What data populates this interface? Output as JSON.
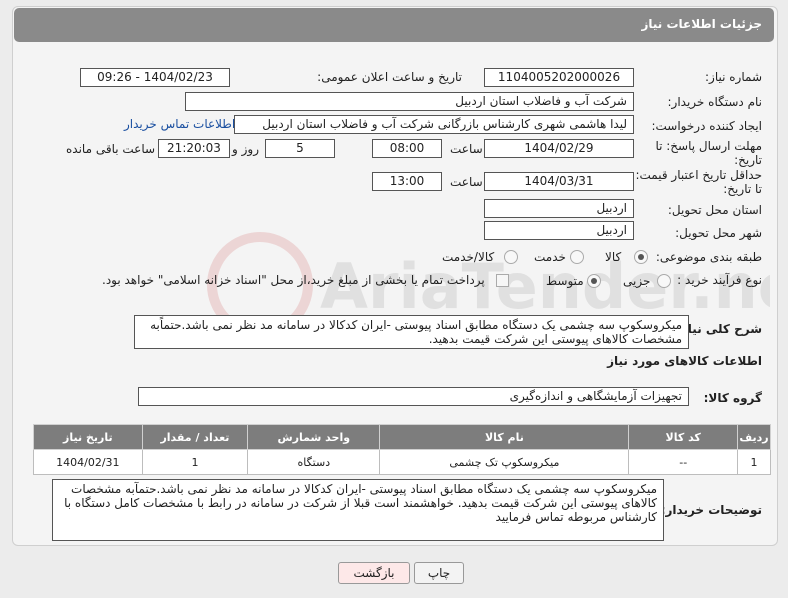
{
  "header": {
    "title": "جزئیات اطلاعات نیاز"
  },
  "form": {
    "need_number_label": "شماره نیاز:",
    "need_number": "1104005202000026",
    "announce_label": "تاریخ و ساعت اعلان عمومی:",
    "announce_value": "1404/02/23 - 09:26",
    "buyer_org_label": "نام دستگاه خریدار:",
    "buyer_org": "شرکت آب و فاضلاب استان اردبیل",
    "creator_label": "ایجاد کننده درخواست:",
    "creator": "لیدا  هاشمی شهری کارشناس بازرگانی شرکت آب و فاضلاب استان اردبیل",
    "contact_link": "اطلاعات تماس خریدار",
    "deadline_label_1": "مهلت ارسال پاسخ: تا",
    "deadline_label_2": "تاریخ:",
    "deadline_date": "1404/02/29",
    "time_label": "ساعت",
    "deadline_time": "08:00",
    "days_value": "5",
    "days_label": "روز و",
    "remaining_time": "21:20:03",
    "remaining_label": "ساعت باقی مانده",
    "price_valid_label_1": "حداقل تاریخ اعتبار قیمت:",
    "price_valid_label_2": "تا تاریخ:",
    "price_valid_date": "1404/03/31",
    "price_valid_time": "13:00",
    "province_label": "استان محل تحویل:",
    "province": "اردبیل",
    "city_label": "شهر محل تحویل:",
    "city": "اردبیل",
    "category_label": "طبقه بندی موضوعی:",
    "category_options": [
      "کالا",
      "خدمت",
      "کالا/خدمت"
    ],
    "process_label": "نوع فرآیند خرید :",
    "process_options": [
      "جزیی",
      "متوسط"
    ],
    "payment_note": "پرداخت تمام یا بخشی از مبلغ خرید،از محل \"اسناد خزانه اسلامی\" خواهد بود.",
    "description_label": "شرح کلی نیاز:",
    "description": "میکروسکوپ سه چشمی  یک دستگاه مطابق اسناد پیوستی -ایران کدکالا در سامانه مد نظر نمی باشد.حتماًبه مشخصات کالاهای پیوستی این شرکت قیمت بدهید."
  },
  "goods": {
    "section_title": "اطلاعات کالاهای مورد نیاز",
    "group_label": "گروه کالا:",
    "group_value": "تجهیزات آزمایشگاهی و اندازه‌گیری",
    "columns": [
      "ردیف",
      "کد کالا",
      "نام کالا",
      "واحد شمارش",
      "تعداد / مقدار",
      "تاریخ نیاز"
    ],
    "rows": [
      [
        "1",
        "--",
        "میکروسکوپ تک چشمی",
        "دستگاه",
        "1",
        "1404/02/31"
      ]
    ]
  },
  "buyer_notes": {
    "label": "توضیحات خریدار:",
    "text": "میکروسکوپ سه چشمی  یک دستگاه مطابق اسناد پیوستی -ایران کدکالا در سامانه مد نظر نمی باشد.حتمآبه مشخصات کالاهای پیوستی این شرکت قیمت بدهید. خواهشمند است قبلا از شرکت در سامانه  در رابط با مشخصات کامل دستگاه با کارشناس مربوطه تماس فرمایید"
  },
  "buttons": {
    "print": "چاپ",
    "back": "بازگشت"
  },
  "watermark": "AriaTender.net"
}
